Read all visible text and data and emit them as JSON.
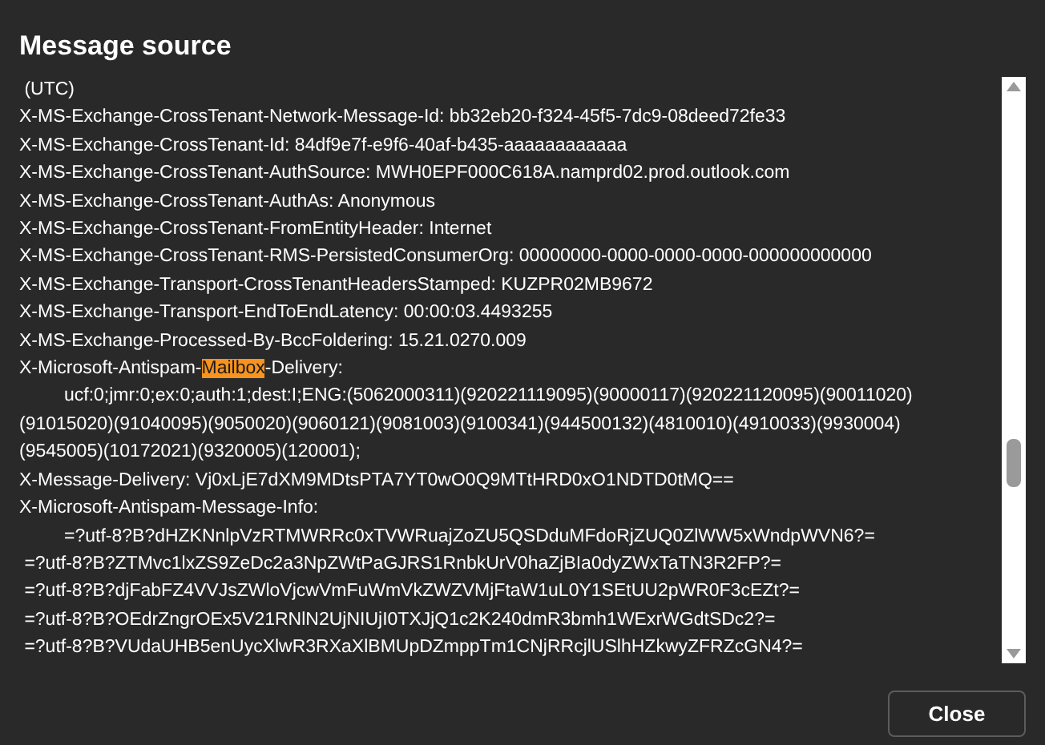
{
  "dialog": {
    "title": "Message source"
  },
  "lines": [
    {
      "indented": false,
      "segments": [
        {
          "text": " (UTC)",
          "highlighted": false
        }
      ]
    },
    {
      "indented": false,
      "segments": [
        {
          "text": "X-MS-Exchange-CrossTenant-Network-Message-Id: bb32eb20-f324-45f5-7dc9-08deed72fe33",
          "highlighted": false
        }
      ]
    },
    {
      "indented": false,
      "segments": [
        {
          "text": "X-MS-Exchange-CrossTenant-Id: 84df9e7f-e9f6-40af-b435-aaaaaaaaaaaa",
          "highlighted": false
        }
      ]
    },
    {
      "indented": false,
      "segments": [
        {
          "text": "X-MS-Exchange-CrossTenant-AuthSource: MWH0EPF000C618A.namprd02.prod.outlook.com",
          "highlighted": false
        }
      ]
    },
    {
      "indented": false,
      "segments": [
        {
          "text": "X-MS-Exchange-CrossTenant-AuthAs: Anonymous",
          "highlighted": false
        }
      ]
    },
    {
      "indented": false,
      "segments": [
        {
          "text": "X-MS-Exchange-CrossTenant-FromEntityHeader: Internet",
          "highlighted": false
        }
      ]
    },
    {
      "indented": false,
      "segments": [
        {
          "text": "X-MS-Exchange-CrossTenant-RMS-PersistedConsumerOrg: 00000000-0000-0000-0000-000000000000",
          "highlighted": false
        }
      ]
    },
    {
      "indented": false,
      "segments": [
        {
          "text": "X-MS-Exchange-Transport-CrossTenantHeadersStamped: KUZPR02MB9672",
          "highlighted": false
        }
      ]
    },
    {
      "indented": false,
      "segments": [
        {
          "text": "X-MS-Exchange-Transport-EndToEndLatency: 00:00:03.4493255",
          "highlighted": false
        }
      ]
    },
    {
      "indented": false,
      "segments": [
        {
          "text": "X-MS-Exchange-Processed-By-BccFoldering: 15.21.0270.009",
          "highlighted": false
        }
      ]
    },
    {
      "indented": false,
      "segments": [
        {
          "text": "X-Microsoft-Antispam-",
          "highlighted": false
        },
        {
          "text": "Mailbox",
          "highlighted": true
        },
        {
          "text": "-Delivery:",
          "highlighted": false
        }
      ]
    },
    {
      "indented": true,
      "segments": [
        {
          "text": "ucf:0;jmr:0;ex:0;auth:1;dest:I;ENG:(5062000311)(920221119095)(90000117)(920221120095)(90011020)",
          "highlighted": false
        }
      ]
    },
    {
      "indented": false,
      "segments": [
        {
          "text": "(91015020)(91040095)(9050020)(9060121)(9081003)(9100341)(944500132)(4810010)(4910033)(9930004)",
          "highlighted": false
        }
      ]
    },
    {
      "indented": false,
      "segments": [
        {
          "text": "(9545005)(10172021)(9320005)(120001);",
          "highlighted": false
        }
      ]
    },
    {
      "indented": false,
      "segments": [
        {
          "text": "X-Message-Delivery: Vj0xLjE7dXM9MDtsPTA7YT0wO0Q9MTtHRD0xO1NDTD0tMQ==",
          "highlighted": false
        }
      ]
    },
    {
      "indented": false,
      "segments": [
        {
          "text": "X-Microsoft-Antispam-Message-Info:",
          "highlighted": false
        }
      ]
    },
    {
      "indented": true,
      "segments": [
        {
          "text": "=?utf-8?B?dHZKNnlpVzRTMWRRc0xTVWRuajZoZU5QSDduMFdoRjZUQ0ZlWW5xWndpWVN6?=",
          "highlighted": false
        }
      ]
    },
    {
      "indented": false,
      "segments": [
        {
          "text": " =?utf-8?B?ZTMvc1lxZS9ZeDc2a3NpZWtPaGJRS1RnbkUrV0haZjBIa0dyZWxTaTN3R2FP?=",
          "highlighted": false
        }
      ]
    },
    {
      "indented": false,
      "segments": [
        {
          "text": " =?utf-8?B?djFabFZ4VVJsZWloVjcwVmFuWmVkZWZVMjFtaW1uL0Y1SEtUU2pWR0F3cEZt?=",
          "highlighted": false
        }
      ]
    },
    {
      "indented": false,
      "segments": [
        {
          "text": " =?utf-8?B?OEdrZngrOEx5V21RNlN2UjNIUjI0TXJjQ1c2K240dmR3bmh1WExrWGdtSDc2?=",
          "highlighted": false
        }
      ]
    },
    {
      "indented": false,
      "segments": [
        {
          "text": " =?utf-8?B?VUdaUHB5enUycXlwR3RXaXlBMUpDZmppTm1CNjRRcjlUSlhHZkwyZFRZcGN4?=",
          "highlighted": false
        }
      ]
    }
  ],
  "buttons": [
    {
      "label": "Close"
    }
  ]
}
